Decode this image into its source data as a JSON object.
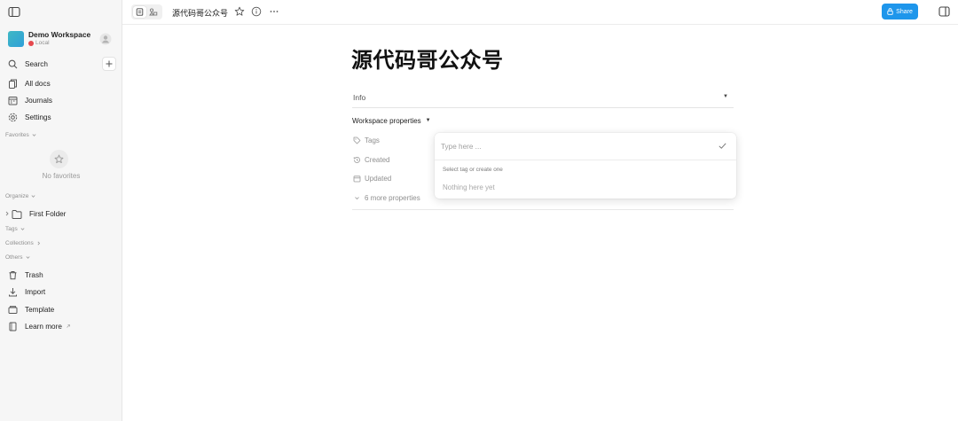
{
  "colors": {
    "accent": "#1e96eb",
    "workspace_logo": "#3fb8c4",
    "status_dot": "#e5484d",
    "sidebar_bg": "#f6f6f6"
  },
  "sidebar": {
    "workspace": {
      "name": "Demo Workspace",
      "status": "Local"
    },
    "search_label": "Search",
    "nav": [
      {
        "label": "All docs",
        "icon": "all-docs-icon"
      },
      {
        "label": "Journals",
        "icon": "journals-icon"
      },
      {
        "label": "Settings",
        "icon": "settings-icon"
      }
    ],
    "favorites": {
      "label": "Favorites",
      "empty_text": "No favorites"
    },
    "organize": {
      "label": "Organize",
      "folder": "First Folder"
    },
    "tags_label": "Tags",
    "collections_label": "Collections",
    "others": {
      "label": "Others",
      "items": [
        {
          "label": "Trash",
          "icon": "trash-icon"
        },
        {
          "label": "Import",
          "icon": "import-icon"
        },
        {
          "label": "Template",
          "icon": "template-icon"
        },
        {
          "label": "Learn more",
          "icon": "learn-more-icon"
        }
      ]
    }
  },
  "topbar": {
    "doc_title": "源代码哥公众号",
    "share_label": "Share"
  },
  "doc": {
    "title": "源代码哥公众号",
    "info_label": "Info",
    "workspace_properties_label": "Workspace properties",
    "properties": [
      {
        "label": "Tags",
        "icon": "tag-icon"
      },
      {
        "label": "Created",
        "icon": "history-icon"
      },
      {
        "label": "Updated",
        "icon": "calendar-icon"
      }
    ],
    "more_properties": "6 more properties"
  },
  "tag_popup": {
    "placeholder": "Type here ...",
    "hint": "Select tag or create one",
    "empty": "Nothing here yet"
  }
}
